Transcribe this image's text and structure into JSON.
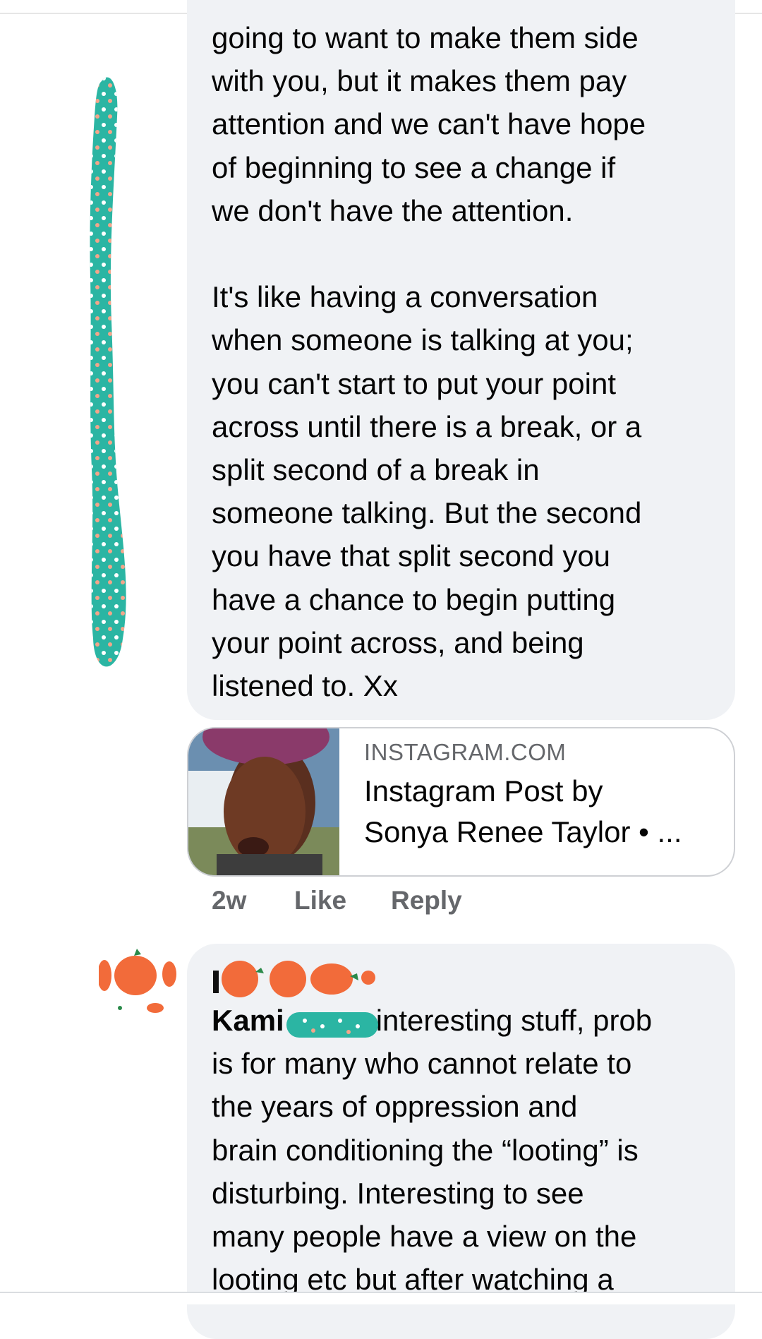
{
  "comment1": {
    "text": "going to want to make them side\nwith you, but it makes them pay\nattention and we can't have hope\nof beginning to see a change if\nwe don't have the attention.\n\nIt's like having a conversation\nwhen someone is talking at you;\nyou can't start to put your point\nacross until there is a break, or a\nsplit second of a break in\nsomeone talking. But the second\nyou have that split second you\nhave a chance to begin putting\nyour point across, and being\nlistened to. Xx"
  },
  "link_preview": {
    "domain": "INSTAGRAM.COM",
    "title": "Instagram Post by\nSonya Renee Taylor • ..."
  },
  "actions": {
    "age": "2w",
    "like": "Like",
    "reply": "Reply"
  },
  "comment2": {
    "author_partial": "Kami",
    "text": "interesting stuff, prob\nis for many who cannot relate to\nthe years of oppression and\nbrain conditioning the “looting” is\ndisturbing. Interesting to see\nmany people have a view on the\nlooting etc but after watching a"
  },
  "colors": {
    "bubble": "#f0f2f5",
    "secondary_text": "#65676b",
    "scribble_teal": "#2bb5a3",
    "scribble_orange": "#f26b3a"
  }
}
